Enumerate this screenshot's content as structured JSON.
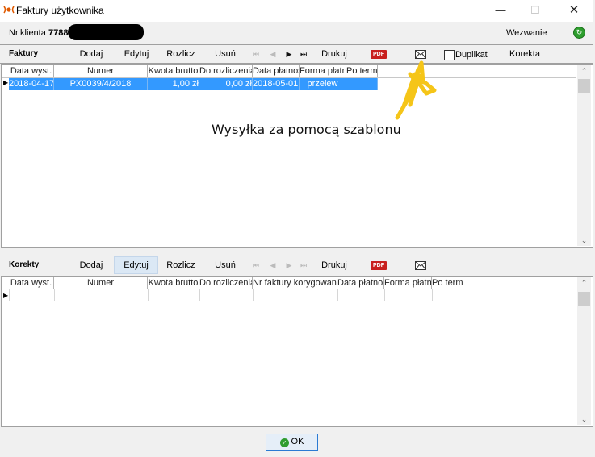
{
  "window": {
    "title": "Faktury użytkownika",
    "controls": {
      "minimize": "—",
      "maximize": "☐",
      "close": "✕"
    }
  },
  "header": {
    "client_label": "Nr.klienta",
    "client_number": "7788",
    "wezwanie_label": "Wezwanie"
  },
  "faktury": {
    "title": "Faktury",
    "toolbar": {
      "add": "Dodaj",
      "edit": "Edytuj",
      "settle": "Rozlicz",
      "delete": "Usuń",
      "nav_first": "⏮",
      "nav_prev": "◀",
      "nav_next": "▶",
      "nav_last": "⏭",
      "print": "Drukuj",
      "pdf": "PDF",
      "duplicate": "Duplikat",
      "correction": "Korekta"
    },
    "columns": [
      "Data wyst.",
      "Numer",
      "Kwota brutto",
      "Do rozliczenia",
      "Data płatności",
      "Forma płatności",
      "Po terminie"
    ],
    "rows": [
      [
        "2018-04-17",
        "PX0039/4/2018",
        "1,00 zł",
        "0,00 zł",
        "2018-05-01",
        "przelew",
        ""
      ]
    ]
  },
  "annotation": "Wysyłka za pomocą szablonu",
  "korekty": {
    "title": "Korekty",
    "toolbar": {
      "add": "Dodaj",
      "edit": "Edytuj",
      "settle": "Rozlicz",
      "delete": "Usuń",
      "print": "Drukuj",
      "pdf": "PDF"
    },
    "columns": [
      "Data wyst.",
      "Numer",
      "Kwota brutto",
      "Do rozliczenia",
      "Nr faktury korygowanej",
      "Data płatności",
      "Forma płatności",
      "Po terminie"
    ]
  },
  "footer": {
    "ok": "OK"
  },
  "colors": {
    "selection": "#3399ff",
    "annotation_marker": "#f5c518",
    "ok_icon": "#2f9c2f",
    "pdf_icon": "#c8201e"
  }
}
